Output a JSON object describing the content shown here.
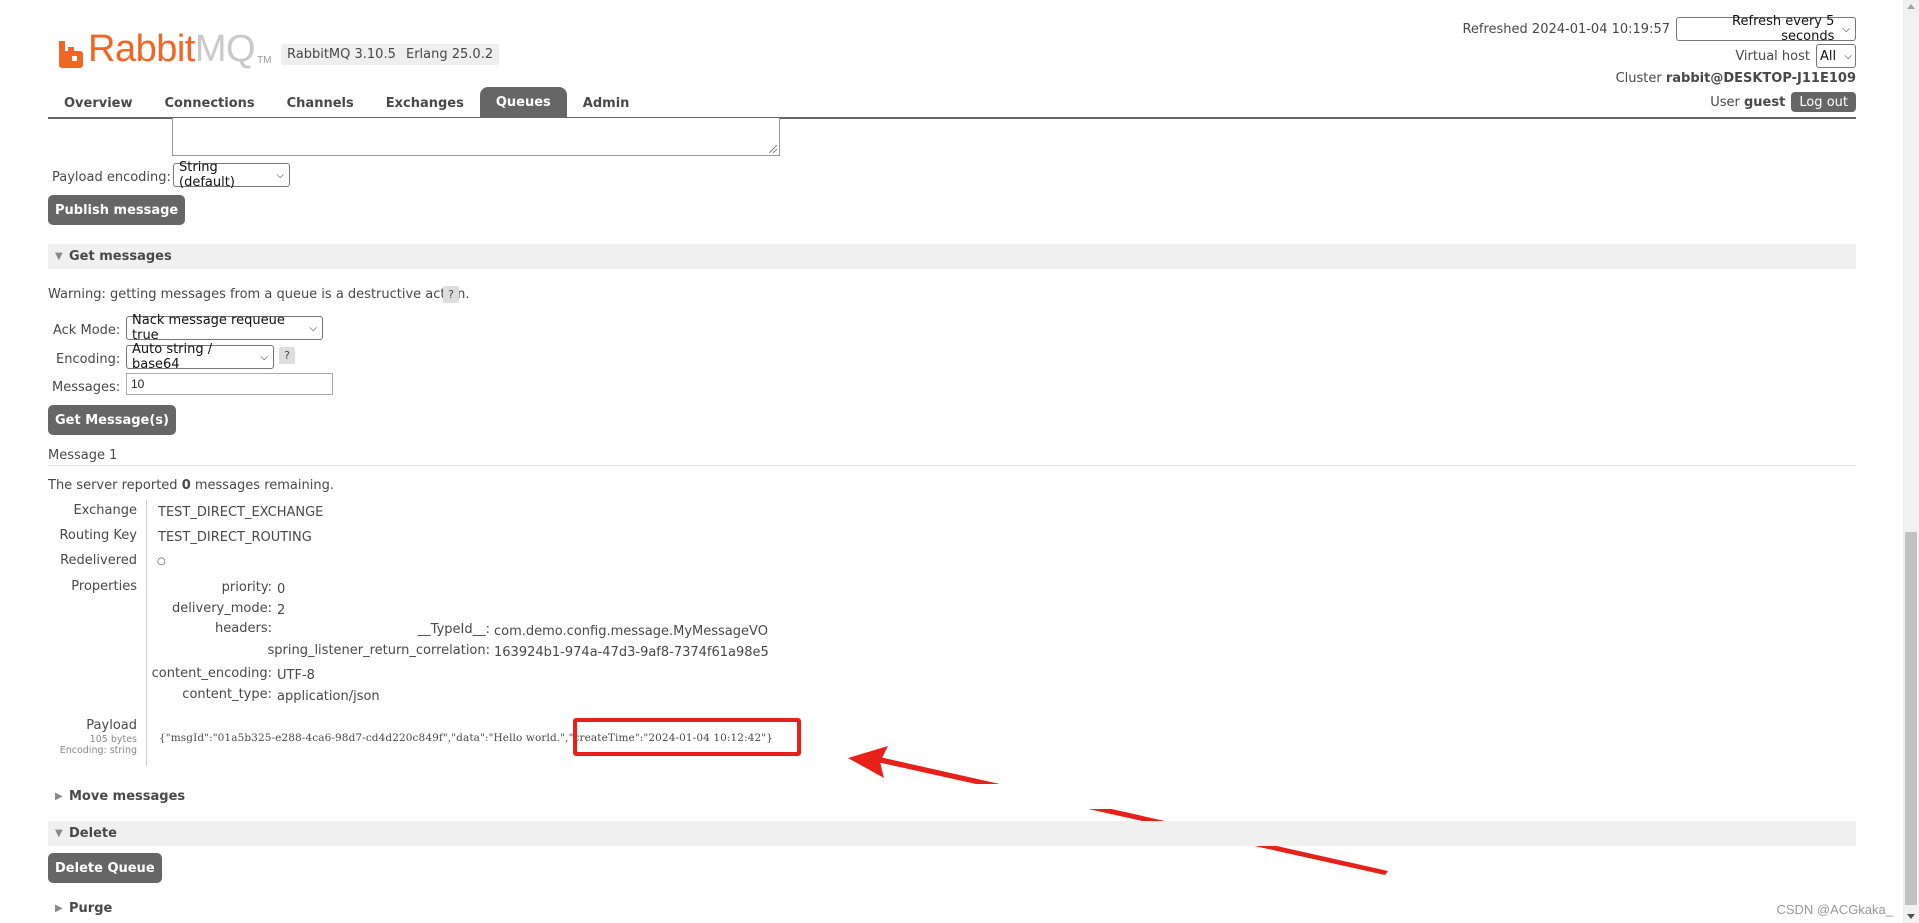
{
  "header": {
    "logo_left": "Rabbit",
    "logo_right": "MQ",
    "logo_tm": "TM",
    "version_badge": "RabbitMQ 3.10.5",
    "erlang_badge": "Erlang 25.0.2",
    "refreshed_label": "Refreshed 2024-01-04 10:19:57",
    "refresh_select": "Refresh every 5 seconds",
    "virtual_host_label": "Virtual host",
    "virtual_host_select": "All",
    "cluster_label": "Cluster",
    "cluster_name": "rabbit@DESKTOP-J11E109",
    "user_label": "User",
    "user_name": "guest",
    "logout_label": "Log out"
  },
  "tabs": [
    {
      "label": "Overview"
    },
    {
      "label": "Connections"
    },
    {
      "label": "Channels"
    },
    {
      "label": "Exchanges"
    },
    {
      "label": "Queues",
      "active": true
    },
    {
      "label": "Admin"
    }
  ],
  "publish": {
    "payload_encoding_label": "Payload encoding:",
    "payload_encoding_select": "String (default)",
    "publish_button": "Publish message"
  },
  "get_messages": {
    "section_title": "Get messages",
    "warning": "Warning: getting messages from a queue is a destructive action.",
    "help": "?",
    "ack_mode_label": "Ack Mode:",
    "ack_mode_select": "Nack message requeue true",
    "encoding_label": "Encoding:",
    "encoding_select": "Auto string / base64",
    "messages_label": "Messages:",
    "messages_value": "10",
    "get_button": "Get Message(s)"
  },
  "message": {
    "title": "Message 1",
    "remaining_prefix": "The server reported ",
    "remaining_count": "0",
    "remaining_suffix": " messages remaining.",
    "exchange_label": "Exchange",
    "exchange_value": "TEST_DIRECT_EXCHANGE",
    "routing_key_label": "Routing Key",
    "routing_key_value": "TEST_DIRECT_ROUTING",
    "redelivered_label": "Redelivered",
    "redelivered_value": "○",
    "properties_label": "Properties",
    "properties": {
      "priority_key": "priority:",
      "priority_value": "0",
      "delivery_mode_key": "delivery_mode:",
      "delivery_mode_value": "2",
      "headers_key": "headers:",
      "typeid_key": "__TypeId__:",
      "typeid_value": "com.demo.config.message.MyMessageVO",
      "correlation_key": "spring_listener_return_correlation:",
      "correlation_value": "163924b1-974a-47d3-9af8-7374f61a98e5",
      "content_encoding_key": "content_encoding:",
      "content_encoding_value": "UTF-8",
      "content_type_key": "content_type:",
      "content_type_value": "application/json"
    },
    "payload_label": "Payload",
    "payload_bytes": "105 bytes",
    "payload_encoding": "Encoding: string",
    "payload_text": "{\"msgId\":\"01a5b325-e288-4ca6-98d7-cd4d220c849f\",\"data\":\"Hello world.\",\"createTime\":\"2024-01-04 10:12:42\"}"
  },
  "sections": {
    "move_messages": "Move messages",
    "delete": "Delete",
    "delete_button": "Delete Queue",
    "purge": "Purge"
  },
  "watermark": "CSDN @ACGkaka_",
  "colors": {
    "brand_orange": "#f26522",
    "tab_active": "#666666",
    "highlight_red": "#e8201a"
  }
}
